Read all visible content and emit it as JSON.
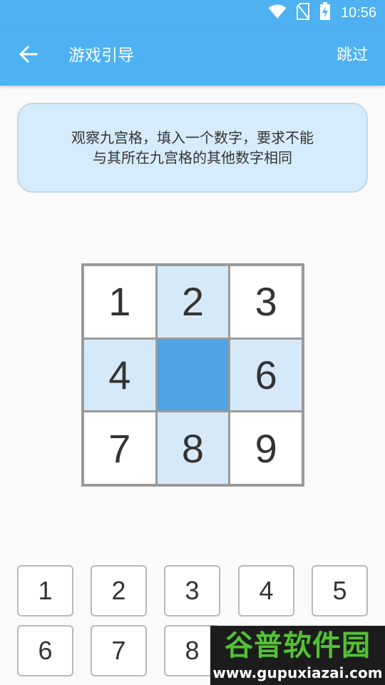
{
  "status_bar": {
    "time": "10:56",
    "icons": [
      "wifi-icon",
      "no-sim-icon",
      "battery-charging-icon"
    ]
  },
  "app_bar": {
    "back_icon": "arrow-left-icon",
    "title": "游戏引导",
    "skip_label": "跳过",
    "background_color": "#4db1f2"
  },
  "hint": {
    "line1": "观察九宫格，填入一个数字，要求不能",
    "line2": "与其所在九宫格的其他数字相同"
  },
  "board": {
    "cells": [
      {
        "value": "1",
        "state": "normal"
      },
      {
        "value": "2",
        "state": "related"
      },
      {
        "value": "3",
        "state": "normal"
      },
      {
        "value": "4",
        "state": "related"
      },
      {
        "value": "",
        "state": "selected"
      },
      {
        "value": "6",
        "state": "related"
      },
      {
        "value": "7",
        "state": "normal"
      },
      {
        "value": "8",
        "state": "related"
      },
      {
        "value": "9",
        "state": "normal"
      }
    ],
    "colors": {
      "normal": "#ffffff",
      "related": "#d6e9f8",
      "selected": "#4fa3e3",
      "border": "#9a9a9a"
    }
  },
  "keypad": {
    "keys": [
      "1",
      "2",
      "3",
      "4",
      "5",
      "6",
      "7",
      "8"
    ]
  },
  "watermark": {
    "name": "谷普软件园",
    "url": "www.gupuxiazai.com"
  }
}
